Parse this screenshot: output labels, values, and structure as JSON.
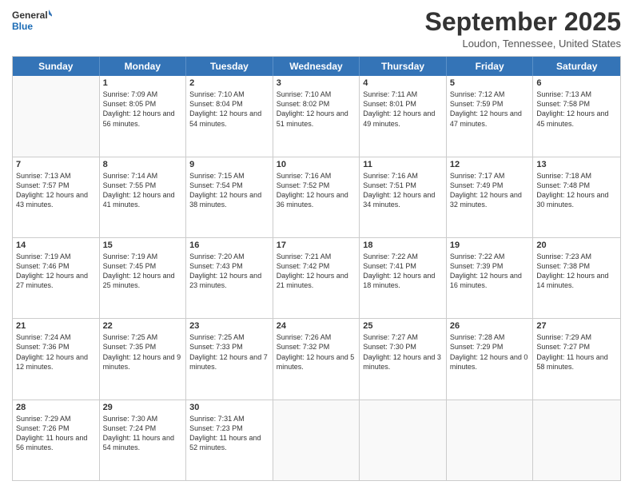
{
  "header": {
    "logo_line1": "General",
    "logo_line2": "Blue",
    "month": "September 2025",
    "location": "Loudon, Tennessee, United States"
  },
  "days_of_week": [
    "Sunday",
    "Monday",
    "Tuesday",
    "Wednesday",
    "Thursday",
    "Friday",
    "Saturday"
  ],
  "rows": [
    [
      {
        "day": "",
        "empty": true
      },
      {
        "day": "1",
        "sunrise": "7:09 AM",
        "sunset": "8:05 PM",
        "daylight": "12 hours and 56 minutes."
      },
      {
        "day": "2",
        "sunrise": "7:10 AM",
        "sunset": "8:04 PM",
        "daylight": "12 hours and 54 minutes."
      },
      {
        "day": "3",
        "sunrise": "7:10 AM",
        "sunset": "8:02 PM",
        "daylight": "12 hours and 51 minutes."
      },
      {
        "day": "4",
        "sunrise": "7:11 AM",
        "sunset": "8:01 PM",
        "daylight": "12 hours and 49 minutes."
      },
      {
        "day": "5",
        "sunrise": "7:12 AM",
        "sunset": "7:59 PM",
        "daylight": "12 hours and 47 minutes."
      },
      {
        "day": "6",
        "sunrise": "7:13 AM",
        "sunset": "7:58 PM",
        "daylight": "12 hours and 45 minutes."
      }
    ],
    [
      {
        "day": "7",
        "sunrise": "7:13 AM",
        "sunset": "7:57 PM",
        "daylight": "12 hours and 43 minutes."
      },
      {
        "day": "8",
        "sunrise": "7:14 AM",
        "sunset": "7:55 PM",
        "daylight": "12 hours and 41 minutes."
      },
      {
        "day": "9",
        "sunrise": "7:15 AM",
        "sunset": "7:54 PM",
        "daylight": "12 hours and 38 minutes."
      },
      {
        "day": "10",
        "sunrise": "7:16 AM",
        "sunset": "7:52 PM",
        "daylight": "12 hours and 36 minutes."
      },
      {
        "day": "11",
        "sunrise": "7:16 AM",
        "sunset": "7:51 PM",
        "daylight": "12 hours and 34 minutes."
      },
      {
        "day": "12",
        "sunrise": "7:17 AM",
        "sunset": "7:49 PM",
        "daylight": "12 hours and 32 minutes."
      },
      {
        "day": "13",
        "sunrise": "7:18 AM",
        "sunset": "7:48 PM",
        "daylight": "12 hours and 30 minutes."
      }
    ],
    [
      {
        "day": "14",
        "sunrise": "7:19 AM",
        "sunset": "7:46 PM",
        "daylight": "12 hours and 27 minutes."
      },
      {
        "day": "15",
        "sunrise": "7:19 AM",
        "sunset": "7:45 PM",
        "daylight": "12 hours and 25 minutes."
      },
      {
        "day": "16",
        "sunrise": "7:20 AM",
        "sunset": "7:43 PM",
        "daylight": "12 hours and 23 minutes."
      },
      {
        "day": "17",
        "sunrise": "7:21 AM",
        "sunset": "7:42 PM",
        "daylight": "12 hours and 21 minutes."
      },
      {
        "day": "18",
        "sunrise": "7:22 AM",
        "sunset": "7:41 PM",
        "daylight": "12 hours and 18 minutes."
      },
      {
        "day": "19",
        "sunrise": "7:22 AM",
        "sunset": "7:39 PM",
        "daylight": "12 hours and 16 minutes."
      },
      {
        "day": "20",
        "sunrise": "7:23 AM",
        "sunset": "7:38 PM",
        "daylight": "12 hours and 14 minutes."
      }
    ],
    [
      {
        "day": "21",
        "sunrise": "7:24 AM",
        "sunset": "7:36 PM",
        "daylight": "12 hours and 12 minutes."
      },
      {
        "day": "22",
        "sunrise": "7:25 AM",
        "sunset": "7:35 PM",
        "daylight": "12 hours and 9 minutes."
      },
      {
        "day": "23",
        "sunrise": "7:25 AM",
        "sunset": "7:33 PM",
        "daylight": "12 hours and 7 minutes."
      },
      {
        "day": "24",
        "sunrise": "7:26 AM",
        "sunset": "7:32 PM",
        "daylight": "12 hours and 5 minutes."
      },
      {
        "day": "25",
        "sunrise": "7:27 AM",
        "sunset": "7:30 PM",
        "daylight": "12 hours and 3 minutes."
      },
      {
        "day": "26",
        "sunrise": "7:28 AM",
        "sunset": "7:29 PM",
        "daylight": "12 hours and 0 minutes."
      },
      {
        "day": "27",
        "sunrise": "7:29 AM",
        "sunset": "7:27 PM",
        "daylight": "11 hours and 58 minutes."
      }
    ],
    [
      {
        "day": "28",
        "sunrise": "7:29 AM",
        "sunset": "7:26 PM",
        "daylight": "11 hours and 56 minutes."
      },
      {
        "day": "29",
        "sunrise": "7:30 AM",
        "sunset": "7:24 PM",
        "daylight": "11 hours and 54 minutes."
      },
      {
        "day": "30",
        "sunrise": "7:31 AM",
        "sunset": "7:23 PM",
        "daylight": "11 hours and 52 minutes."
      },
      {
        "day": "",
        "empty": true
      },
      {
        "day": "",
        "empty": true
      },
      {
        "day": "",
        "empty": true
      },
      {
        "day": "",
        "empty": true
      }
    ]
  ]
}
